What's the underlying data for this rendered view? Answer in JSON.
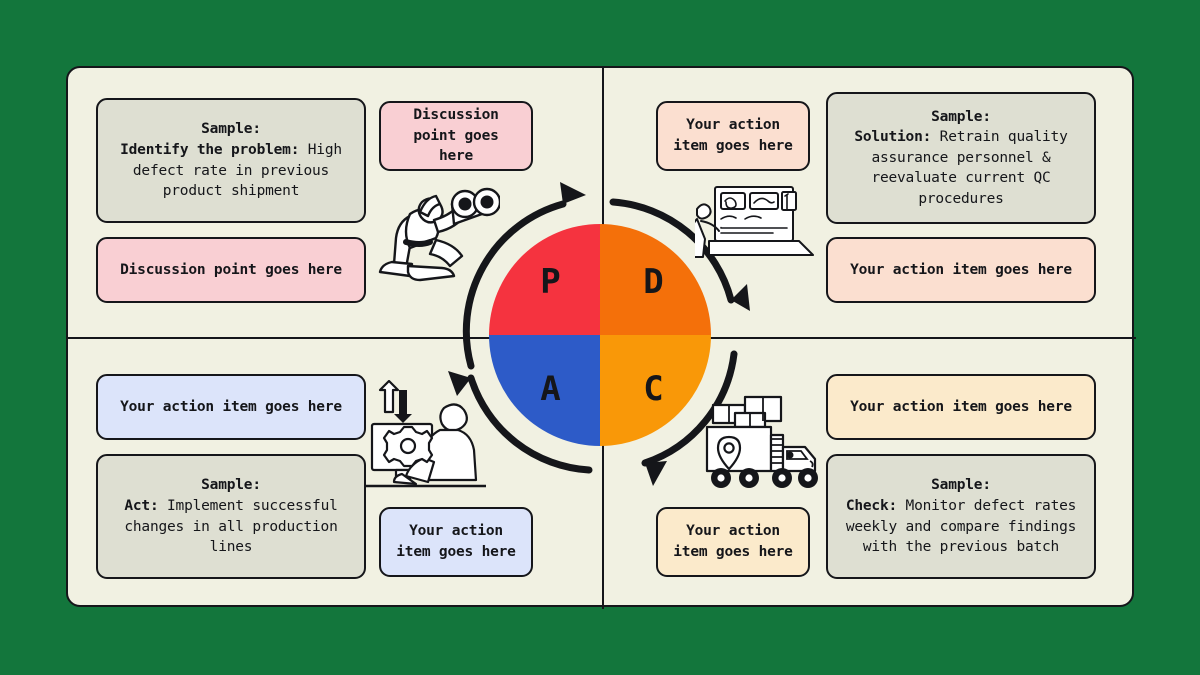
{
  "theme": {
    "background": "#13763c",
    "panel": "#f1f1e2",
    "outline": "#15161a",
    "sample_card": "#dedfd2",
    "plan_accent": "#f5333f",
    "do_accent": "#f4700a",
    "check_accent": "#f99808",
    "act_accent": "#2d5bc8",
    "plan_card": "#f9cfd3",
    "do_card": "#fbdfd0",
    "check_card": "#fbeacb",
    "act_card": "#dce4fa"
  },
  "cycle": {
    "letters": [
      {
        "key": "plan",
        "label": "P"
      },
      {
        "key": "do",
        "label": "D"
      },
      {
        "key": "check",
        "label": "C"
      },
      {
        "key": "act",
        "label": "A"
      }
    ]
  },
  "quadrants": {
    "plan": {
      "sample_heading": "Sample:",
      "sample_term": "Identify the problem:",
      "sample_body": " High defect rate in previous product shipment",
      "action_small": "Discussion point goes here",
      "action_wide": "Discussion point goes here",
      "illustration": "person-with-binoculars-illustration"
    },
    "do": {
      "sample_heading": "Sample:",
      "sample_term": "Solution:",
      "sample_body": " Retrain quality assurance personnel & reevaluate current QC procedures",
      "action_small": "Your action item goes here",
      "action_wide": "Your action item goes here",
      "illustration": "person-presenting-laptop-illustration"
    },
    "check": {
      "sample_heading": "Sample:",
      "sample_term": "Check:",
      "sample_body": " Monitor defect rates weekly and compare findings with the previous batch",
      "action_small": "Your action item goes here",
      "action_wide": "Your action item goes here",
      "illustration": "delivery-truck-illustration"
    },
    "act": {
      "sample_heading": "Sample:",
      "sample_term": "Act:",
      "sample_body": " Implement successful changes in all production lines",
      "action_small": "Your action item goes here",
      "action_wide": "Your action item goes here",
      "illustration": "person-at-monitor-gear-illustration"
    }
  }
}
